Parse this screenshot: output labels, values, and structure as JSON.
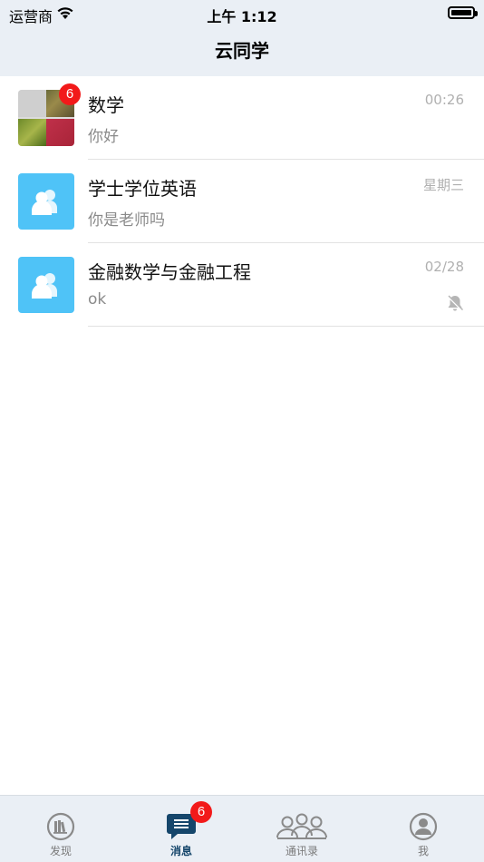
{
  "status_bar": {
    "carrier": "运营商",
    "time": "上午 1:12"
  },
  "nav": {
    "title": "云同学"
  },
  "conversations": [
    {
      "avatar": "photo-collage",
      "title": "数学",
      "message": "你好",
      "time": "00:26",
      "badge": "6",
      "muted": false
    },
    {
      "avatar": "group-icon",
      "title": "学士学位英语",
      "message": "你是老师吗",
      "time": "星期三",
      "badge": "",
      "muted": false
    },
    {
      "avatar": "group-icon",
      "title": "金融数学与金融工程",
      "message": "ok",
      "time": "02/28",
      "badge": "",
      "muted": true
    }
  ],
  "tabbar": {
    "tabs": [
      {
        "label": "发现",
        "icon": "books-icon",
        "active": false
      },
      {
        "label": "消息",
        "icon": "message-icon",
        "active": true,
        "badge": "6"
      },
      {
        "label": "通讯录",
        "icon": "contacts-icon",
        "active": false
      },
      {
        "label": "我",
        "icon": "profile-icon",
        "active": false
      }
    ]
  },
  "colors": {
    "bar_background": "#EAEFF5",
    "group_avatar": "#4FC3F7",
    "badge": "#F21A1A",
    "active_tab": "#15466B"
  }
}
